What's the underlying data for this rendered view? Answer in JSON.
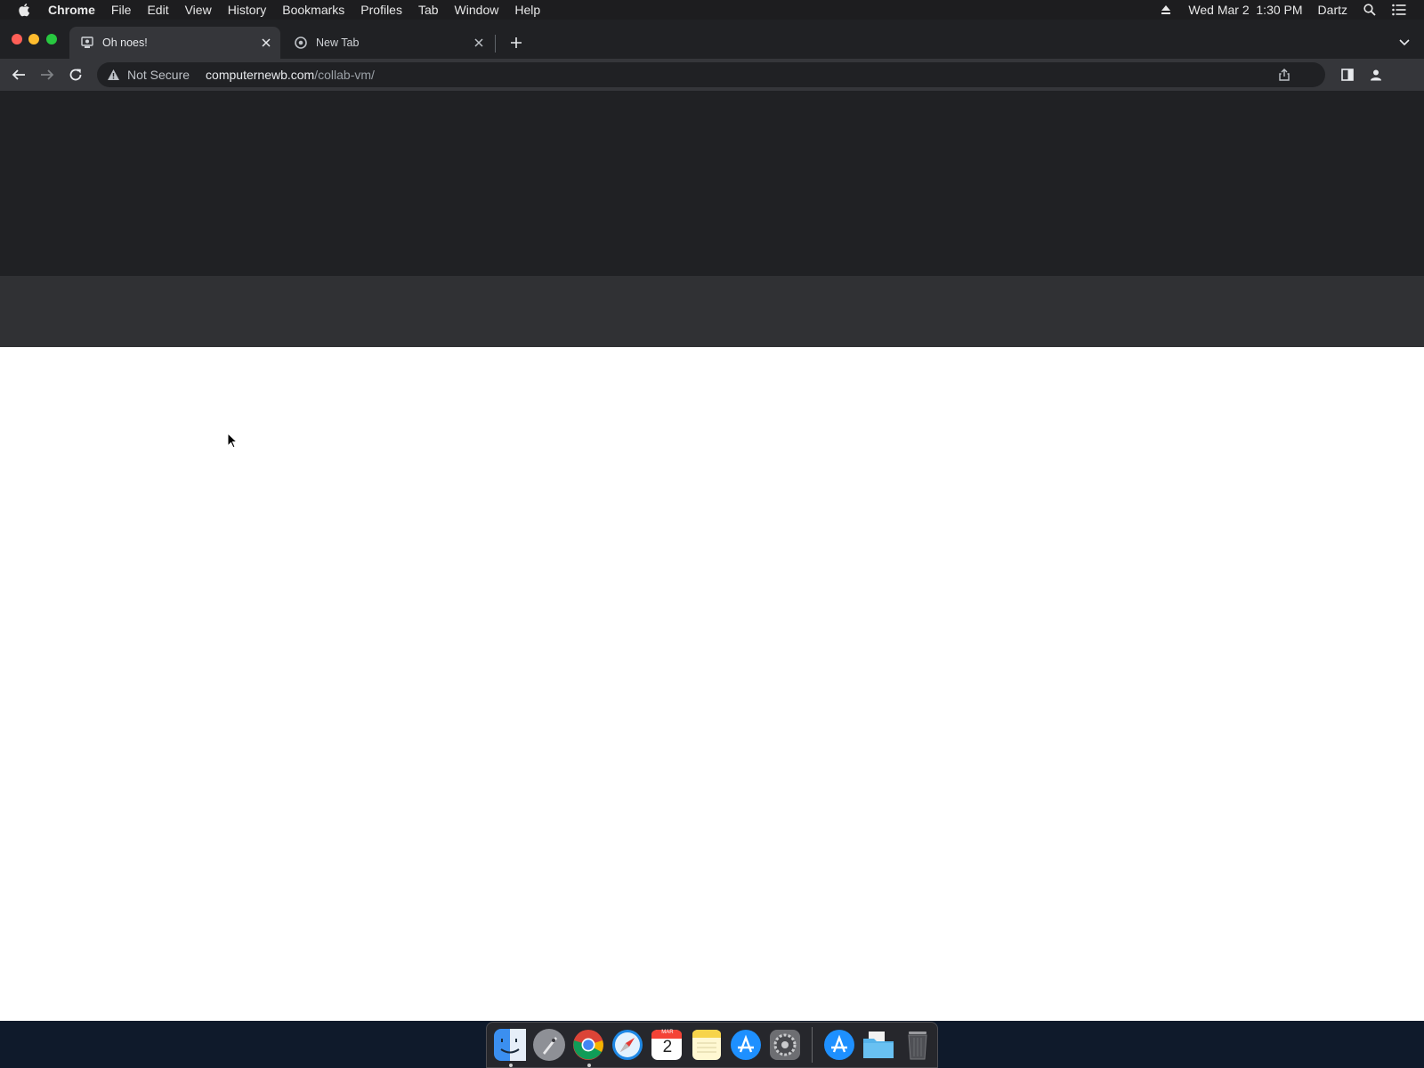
{
  "menubar": {
    "app_name": "Chrome",
    "items": [
      "File",
      "Edit",
      "View",
      "History",
      "Bookmarks",
      "Profiles",
      "Tab",
      "Window",
      "Help"
    ],
    "datetime": "Wed Mar 2  1:30 PM",
    "user": "Dartz"
  },
  "tabs": [
    {
      "title": "Oh noes!",
      "active": true
    },
    {
      "title": "New Tab",
      "active": false
    }
  ],
  "omnibox": {
    "security_label": "Not Secure",
    "host": "computernewb.com",
    "path": "/collab-vm/"
  },
  "dock": {
    "calendar_month": "MAR",
    "calendar_day": "2",
    "items": [
      "finder",
      "launchpad",
      "chrome",
      "safari",
      "calendar",
      "notes",
      "app-store",
      "system-preferences",
      "app-store-downloads",
      "downloads-folder",
      "trash"
    ]
  },
  "colors": {
    "menubar_bg": "#1d1d1f",
    "tabstrip_bg": "#202124",
    "toolbar_bg": "#35363a",
    "page_dark_band": "#202124",
    "page_gray_band": "#303134"
  }
}
